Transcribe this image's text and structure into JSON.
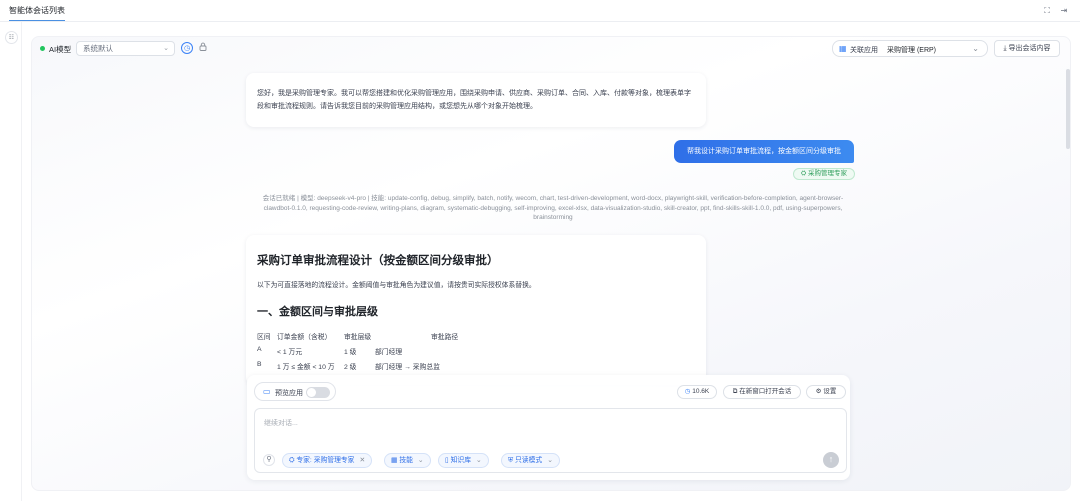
{
  "topbar": {
    "tab_label": "智能体会话列表",
    "expand_icon": "⛶",
    "collapse_icon": "⇥"
  },
  "rail": {
    "menu_icon": "☷"
  },
  "toolbar": {
    "status_label": "AI模型",
    "model_value": "系统默认",
    "clock_icon": "◷",
    "lock_icon": "🔒",
    "related_label": "关联应用",
    "related_value": "采购管理 (ERP)",
    "export_label": "导出会话内容"
  },
  "messages": {
    "intro": "您好，我是采购管理专家。我可以帮您搭建和优化采购管理应用，围绕采购申请、供应商、采购订单、合同、入库、付款等对象，梳理表单字段和审批流程规则。请告诉我您目前的采购管理应用结构，或您想先从哪个对象开始梳理。",
    "user": "帮我设计采购订单审批流程，按金额区间分级审批",
    "expert_tag": "采购管理专家",
    "meta": "会话已就绪 | 模型: deepseek-v4-pro | 技能: update-config, debug, simplify, batch, notify, wecom, chart, test-driven-development, word-docx, playwright-skill, verification-before-completion, agent-browser-clawdbot-0.1.0, requesting-code-review, writing-plans, diagram, systematic-debugging, self-improving, excel-xlsx, data-visualization-studio, skill-creator, ppt, find-skills-skill-1.0.0, pdf, using-superpowers, brainstorming"
  },
  "answer": {
    "title": "采购订单审批流程设计（按金额区间分级审批）",
    "lead": "以下为可直接落地的流程设计。金额阈值与审批角色为建议值，请按贵司实际授权体系替换。",
    "section1": "一、金额区间与审批层级",
    "table": {
      "headers": [
        "区间",
        "订单金额（含税）",
        "审批层级",
        "审批路径"
      ],
      "rows": [
        [
          "A",
          "< 1 万元",
          "1 级",
          "部门经理"
        ],
        [
          "B",
          "1 万 ≤ 金额 < 10 万",
          "2 级",
          "部门经理 → 采购总监"
        ]
      ]
    }
  },
  "composer": {
    "preview_label": "预览应用",
    "token_label": "10.6K",
    "new_window_label": "在新窗口打开会话",
    "settings_label": "设置",
    "placeholder": "继续对话...",
    "expert_chip": "专家: 采购管理专家",
    "skills_chip": "技能",
    "knowledge_chip": "知识库",
    "mode_chip": "只读模式"
  },
  "colors": {
    "accent": "#2f6fe8",
    "status_online": "#22c55e",
    "expert_green": "#2f9e5c"
  }
}
